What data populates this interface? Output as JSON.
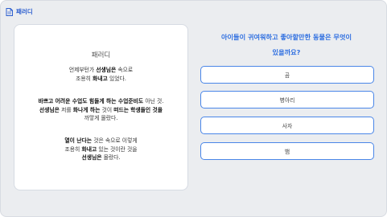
{
  "header": {
    "title": "패러디"
  },
  "passage": {
    "title": "패러디",
    "p1": [
      [
        [
          "언제부턴가 ",
          false
        ],
        [
          "선생님은",
          true
        ],
        [
          " 속으로",
          false
        ]
      ],
      [
        [
          "조용히 ",
          false
        ],
        [
          "화내고",
          true
        ],
        [
          " 있었다.",
          false
        ]
      ]
    ],
    "p2": [
      [
        [
          "바쁘고 어려운 수업도 힘들게 하는 수업준비도",
          true
        ],
        [
          " 아닌 것.",
          false
        ]
      ],
      [
        [
          "선생님은",
          true
        ],
        [
          " 저를 ",
          false
        ],
        [
          "화나게 하는",
          true
        ],
        [
          " 것이 ",
          false
        ],
        [
          "떠드는",
          true
        ],
        [
          " ",
          false
        ],
        [
          "학생들인 것을",
          true
        ]
      ],
      [
        [
          "까맣게 몰랐다.",
          false
        ]
      ]
    ],
    "p3": [
      [
        [
          "열이 난다는",
          true
        ],
        [
          " 것은 속으로 이렇게",
          false
        ]
      ],
      [
        [
          "조용히 ",
          false
        ],
        [
          "화내고",
          true
        ],
        [
          " 있는 것이란 것을",
          false
        ]
      ],
      [
        [
          "선생님은",
          true
        ],
        [
          " 몰랐다.",
          false
        ]
      ]
    ]
  },
  "question": {
    "line1": "아이들이 귀여워하고 좋아할만한 동물은 무엇이",
    "line2": "있을까요?"
  },
  "options": [
    "곰",
    "병아리",
    "사자",
    "뱀"
  ],
  "colors": {
    "accent": "#2f6fe0",
    "option_border": "#4a86e8",
    "background": "#ebedf0"
  },
  "icons": {
    "header": "document-icon"
  }
}
